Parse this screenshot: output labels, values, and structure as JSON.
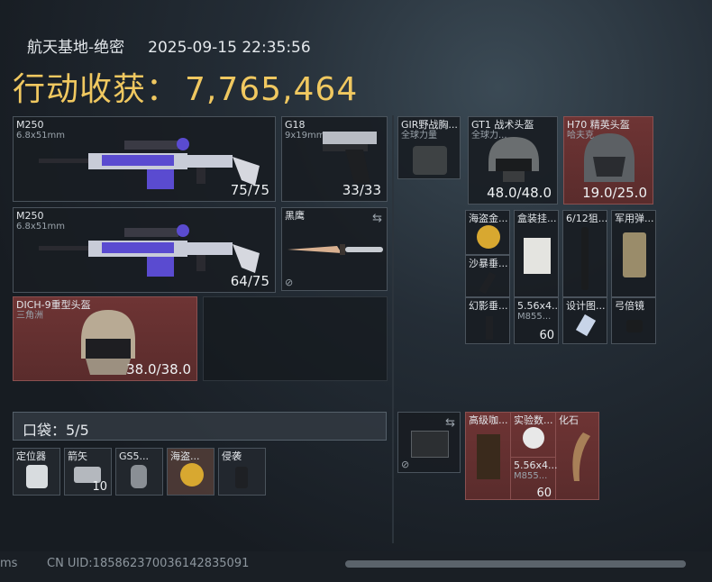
{
  "header": {
    "map": "航天基地-绝密",
    "datetime": "2025-09-15 22:35:56",
    "income_label": "行动收获：",
    "income_value": "7,765,464"
  },
  "loadout": [
    {
      "id": "weapon1",
      "name": "M250",
      "sub": "6.8x51mm",
      "durability": "75/75"
    },
    {
      "id": "weapon2",
      "name": "M250",
      "sub": "6.8x51mm",
      "durability": "64/75"
    },
    {
      "id": "pistol",
      "name": "G18",
      "sub": "9x19mm",
      "durability": "33/33"
    },
    {
      "id": "melee",
      "name": "黑鹰"
    },
    {
      "id": "helmet",
      "name": "DICH-9重型头盔",
      "sub": "三角洲",
      "durability": "38.0/38.0"
    }
  ],
  "pocket": {
    "label": "口袋：5/5",
    "items": [
      {
        "name": "定位器"
      },
      {
        "name": "箭矢",
        "count": "10"
      },
      {
        "name": "GS5..."
      },
      {
        "name": "海盗..."
      },
      {
        "name": "侵袭"
      }
    ]
  },
  "right_top": [
    {
      "name": "GIR野战胸...",
      "sub": "全球力量"
    },
    {
      "name": "GT1 战术头盔",
      "sub": "全球力...",
      "durability": "48.0/48.0"
    },
    {
      "name": "H70 精英头盔",
      "sub": "哈夫克",
      "durability": "19.0/25.0"
    }
  ],
  "right_grid": [
    {
      "name": "海盗金..."
    },
    {
      "name": "盒装挂..."
    },
    {
      "name": "6/12狙..."
    },
    {
      "name": "军用弹..."
    },
    {
      "name": "沙暴垂..."
    },
    {
      "name": "幻影垂..."
    },
    {
      "name": "5.56x4...",
      "sub": "M855...",
      "count": "60"
    },
    {
      "name": "设计图..."
    },
    {
      "name": "弓倍镜"
    }
  ],
  "container": {
    "items": [
      {
        "name": "高级咖..."
      },
      {
        "name": "实验数..."
      },
      {
        "name": "化石"
      },
      {
        "name": "5.56x4...",
        "sub": "M855...",
        "count": "60"
      }
    ]
  },
  "footer": {
    "ms": "ms",
    "uid": "CN UID:1858623700361428350​91"
  },
  "colors": {
    "accent_gold": "#f0c860",
    "rare_red": "#6e3434",
    "purple_camo": "#5a4bd0"
  }
}
